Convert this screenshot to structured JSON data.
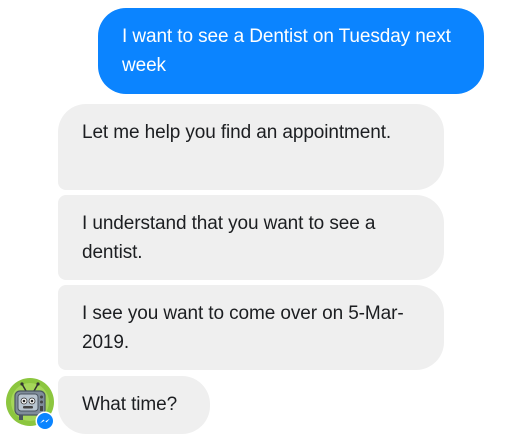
{
  "conversation": {
    "messages": [
      {
        "sender": "user",
        "text": "I want to see a Dentist on Tuesday next week"
      },
      {
        "sender": "bot",
        "text": "Let me help you find an appointment."
      },
      {
        "sender": "bot",
        "text": "I understand that you want to see a dentist."
      },
      {
        "sender": "bot",
        "text": "I see you want to come over on 5-Mar-2019."
      },
      {
        "sender": "bot",
        "text": "What time?"
      }
    ],
    "bot_avatar": {
      "icon": "tv-robot-icon",
      "badge_icon": "messenger-icon"
    }
  },
  "colors": {
    "outgoing_bubble": "#0b84ff",
    "incoming_bubble": "#efefef",
    "outgoing_text": "#ffffff",
    "incoming_text": "#1c1e21"
  }
}
